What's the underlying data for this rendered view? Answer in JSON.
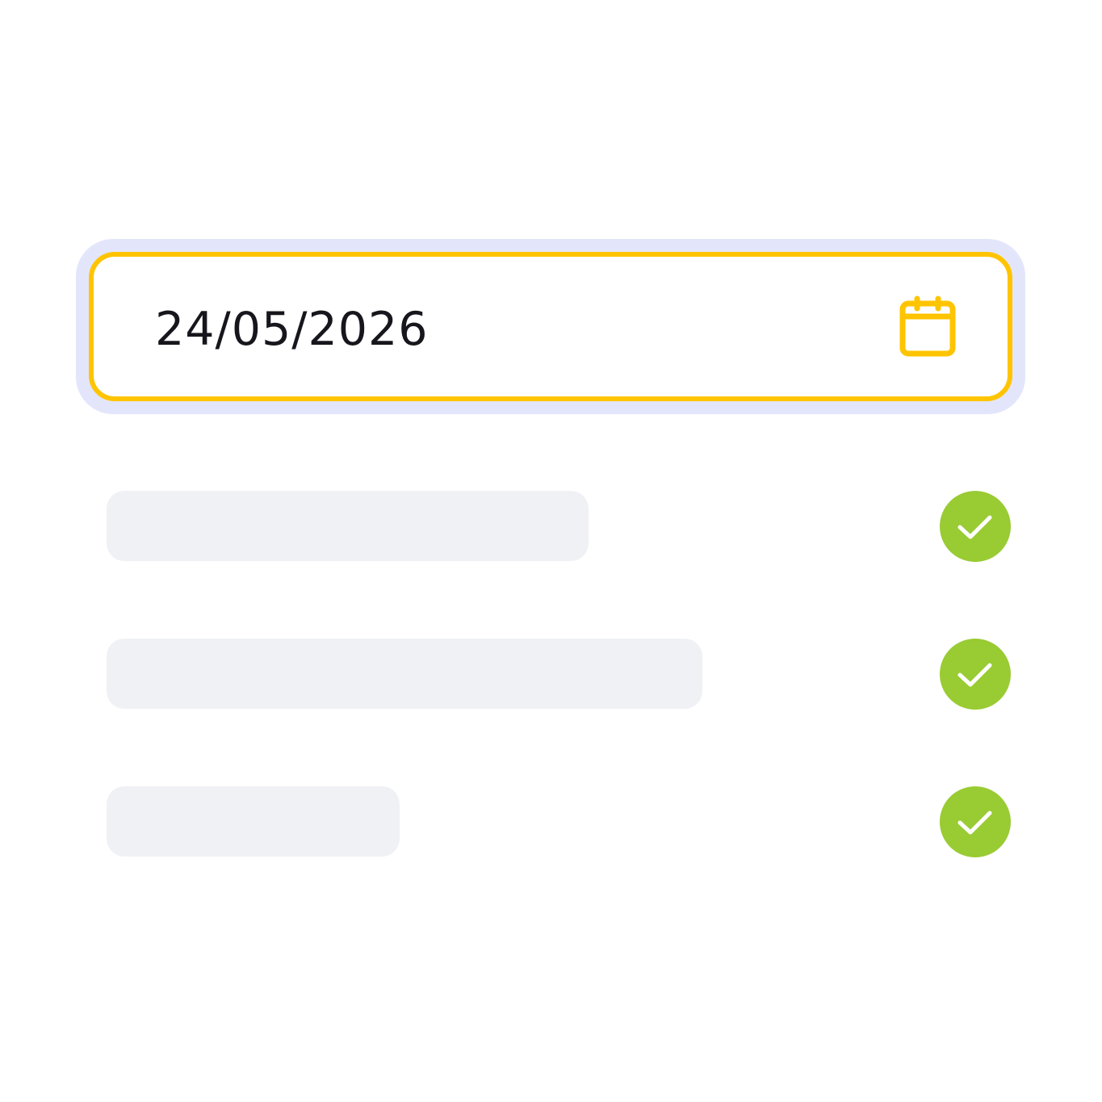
{
  "date_picker": {
    "value": "24/05/2026",
    "icon": "calendar-icon",
    "border_color": "#ffc400",
    "focus_ring_color": "#e3e6fb"
  },
  "validation_rows": [
    {
      "status": "valid",
      "icon": "check-icon",
      "color": "#99cb33"
    },
    {
      "status": "valid",
      "icon": "check-icon",
      "color": "#99cb33"
    },
    {
      "status": "valid",
      "icon": "check-icon",
      "color": "#99cb33"
    }
  ]
}
